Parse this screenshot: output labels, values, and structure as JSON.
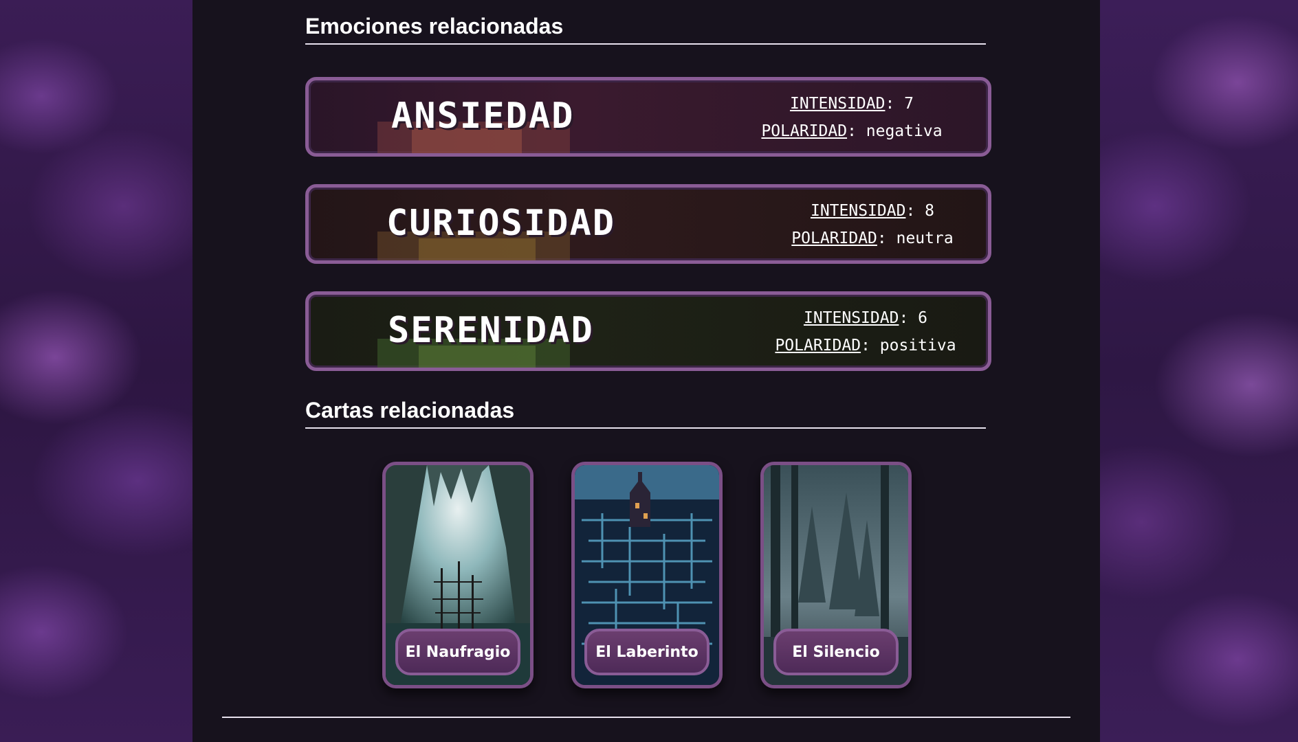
{
  "sections": {
    "emotions_title": "Emociones relacionadas",
    "cards_title": "Cartas relacionadas"
  },
  "labels": {
    "intensity": "INTENSIDAD",
    "polarity": "POLARIDAD"
  },
  "emotions": [
    {
      "name": "ANSIEDAD",
      "intensity": "7",
      "polarity": "negativa",
      "tint": "#3a1a2e"
    },
    {
      "name": "CURIOSIDAD",
      "intensity": "8",
      "polarity": "neutra",
      "tint": "#2e1a1c"
    },
    {
      "name": "SERENIDAD",
      "intensity": "6",
      "polarity": "positiva",
      "tint": "#1e2216"
    }
  ],
  "cards": [
    {
      "title": "El Naufragio",
      "art": "shipwreck-cave"
    },
    {
      "title": "El Laberinto",
      "art": "labyrinth-city"
    },
    {
      "title": "El Silencio",
      "art": "misty-forest"
    }
  ],
  "colors": {
    "frame": "#8a5c96",
    "page_bg": "#17121d",
    "side_bg": "#3a1f52"
  }
}
